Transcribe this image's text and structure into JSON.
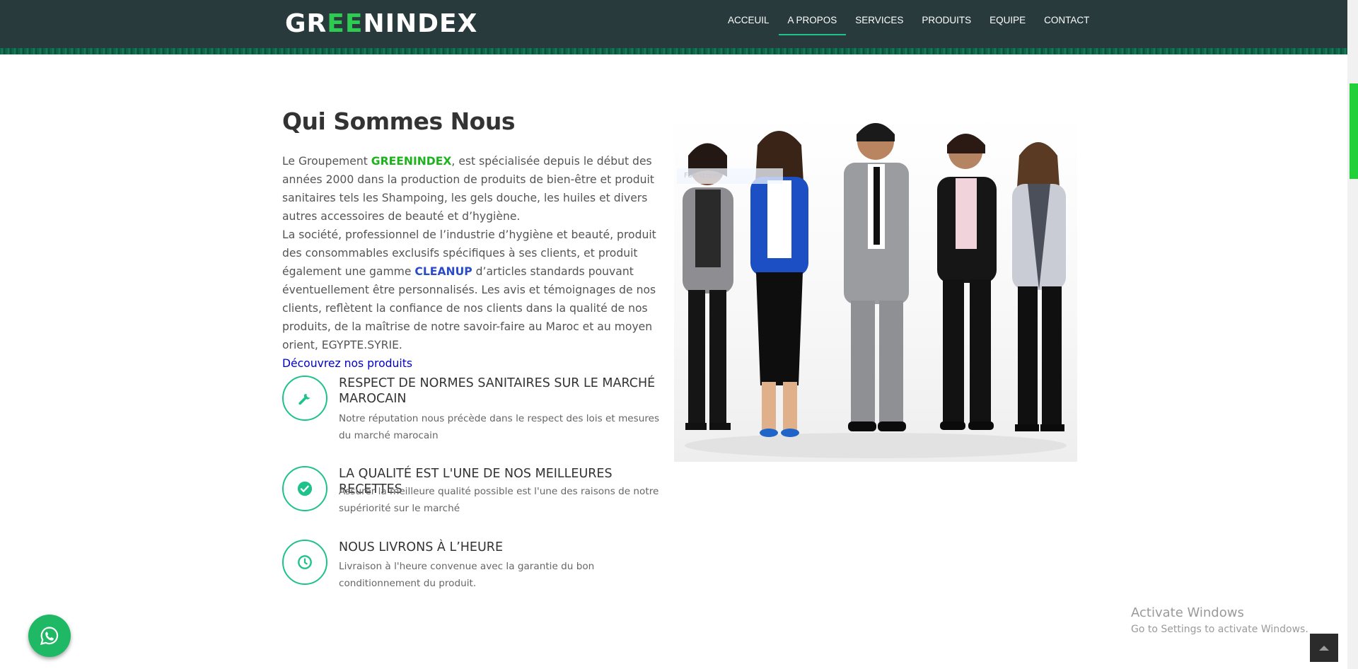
{
  "header": {
    "logo": {
      "part1": "GR",
      "part2": "EE",
      "part3": "NINDEX"
    },
    "nav": [
      {
        "label": "ACCEUIL"
      },
      {
        "label": "A PROPOS"
      },
      {
        "label": "SERVICES"
      },
      {
        "label": "PRODUITS"
      },
      {
        "label": "EQUIPE"
      },
      {
        "label": "CONTACT"
      }
    ],
    "active_nav": "A PROPOS"
  },
  "about": {
    "title": "Qui Sommes Nous",
    "p1_before": "Le Groupement ",
    "p1_brand": "GREENINDEX",
    "p1_after": ", est spécialisée depuis le début des années 2000 dans la production de produits de bien-être et produit sanitaires tels les Shampoing, les gels douche, les huiles et divers autres accessoires de beauté et d’hygiène.",
    "p2_before": "La société, professionnel de l’industrie d’hygiène et beauté, produit des consommables exclusifs spécifiques à ses clients, et produit également une gamme ",
    "p2_brand": "CLEANUP",
    "p2_after": " d’articles standards pouvant éventuellement être personnalisés. Les avis et témoignages de nos clients, reflètent la confiance de nos clients dans la qualité de nos produits, de la maîtrise de notre savoir-faire au Maroc et au moyen orient, EGYPTE.SYRIE.",
    "link": "Découvrez nos produits"
  },
  "features": [
    {
      "icon": "wrench-icon",
      "title": "RESPECT DE NORMES SANITAIRES SUR LE MARCHÉ MAROCAIN",
      "text": "Notre réputation nous précède dans le respect des lois et mesures du marché marocain"
    },
    {
      "icon": "check-circle-icon",
      "title": "LA QUALITÉ EST L'UNE DE NOS MEILLEURES RECETTES",
      "text": "Assurer la meilleure qualité possible est l'une des raisons de notre supériorité sur le marché"
    },
    {
      "icon": "clock-icon",
      "title": "NOUS LIVRONS À L’HEURE",
      "text": "Livraison à l'heure convenue avec la garantie du bon conditionnement du produit."
    }
  ],
  "photo": {
    "overlay_label": "Full-screen"
  },
  "windows_watermark": {
    "line1": "Activate Windows",
    "line2": "Go to Settings to activate Windows."
  },
  "colors": {
    "header_bg": "#283a3c",
    "accent": "#1fc28b",
    "brand_green": "#1db31d",
    "brand_blue": "#2a4cc9",
    "whatsapp": "#1fb865"
  }
}
